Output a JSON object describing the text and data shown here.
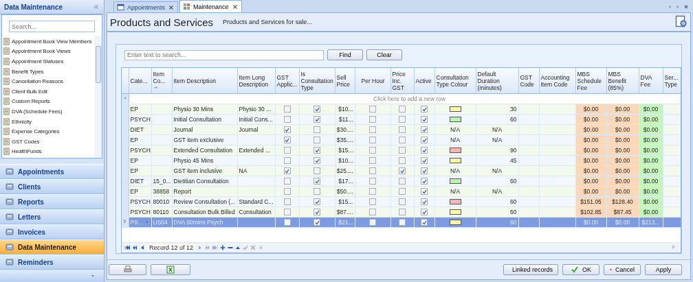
{
  "sidebar": {
    "title": "Data Maintenance",
    "search": {
      "placeholder": "Search..."
    },
    "items": [
      {
        "label": "Appointment Book View Members"
      },
      {
        "label": "Appointment Book Views"
      },
      {
        "label": "Appointment Statuses"
      },
      {
        "label": "Benefit Types"
      },
      {
        "label": "Cancellation Reasons"
      },
      {
        "label": "Client Bulk Edit"
      },
      {
        "label": "Custom Reports"
      },
      {
        "label": "DVA (Schedule Fees)"
      },
      {
        "label": "Ethnicity"
      },
      {
        "label": "Expense Categories"
      },
      {
        "label": "GST Codes"
      },
      {
        "label": "HealthFunds"
      }
    ],
    "nav": [
      {
        "label": "Appointments",
        "selected": false
      },
      {
        "label": "Clients",
        "selected": false
      },
      {
        "label": "Reports",
        "selected": false
      },
      {
        "label": "Letters",
        "selected": false
      },
      {
        "label": "Invoices",
        "selected": false
      },
      {
        "label": "Data Maintenance",
        "selected": true
      },
      {
        "label": "Reminders",
        "selected": false
      }
    ]
  },
  "tabs": [
    {
      "label": "Appointments",
      "selected": false
    },
    {
      "label": "Maintenance",
      "selected": true
    }
  ],
  "header": {
    "title": "Products and Services",
    "subtitle": "Products and Services for sale..."
  },
  "search": {
    "placeholder": "Enter text to search...",
    "buttons": [
      "Find",
      "Clear"
    ]
  },
  "table": {
    "columns": [
      {
        "label": "Cate...",
        "sorted": false
      },
      {
        "label": "Item Co...",
        "sorted": true
      },
      {
        "label": "Item Description",
        "sorted": false
      },
      {
        "label": "Item Long Description",
        "sorted": false
      },
      {
        "label": "GST Applic...",
        "sorted": false
      },
      {
        "label": "Is Consultation Type",
        "sorted": false
      },
      {
        "label": "Sell Price",
        "sorted": false
      },
      {
        "label": "Per Hour",
        "sorted": false
      },
      {
        "label": "Price Inc. GST",
        "sorted": false
      },
      {
        "label": "Active",
        "sorted": false
      },
      {
        "label": "Consultation Type Colour",
        "sorted": false
      },
      {
        "label": "Default Duration (minutes)",
        "sorted": false
      },
      {
        "label": "GST Code",
        "sorted": false
      },
      {
        "label": "Accounting Item Code",
        "sorted": false
      },
      {
        "label": "MBS Schedule Fee",
        "sorted": false
      },
      {
        "label": "MBS Benefit (85%)",
        "sorted": false
      },
      {
        "label": "DVA Fee",
        "sorted": false
      },
      {
        "label": "Ser... Type",
        "sorted": false
      }
    ],
    "new_row": "Click here to add a new row",
    "rows": [
      {
        "category": "EP",
        "description": "Physio 30 Mins",
        "long_description": "Physio 30 ...",
        "gst_applicable": false,
        "consultation": true,
        "sell_price": "$10...",
        "per_hour": false,
        "price_inc_gst": false,
        "active": true,
        "color": "#fbf7a6",
        "duration": "30",
        "mbs_fee": "$0.00",
        "mbs_benefit": "$0.00",
        "dva_fee": "$0.00",
        "selected": false
      },
      {
        "category": "PSYCH",
        "description": "Initial Consultation",
        "long_description": "Initial Cons...",
        "gst_applicable": false,
        "consultation": true,
        "sell_price": "$11...",
        "per_hour": false,
        "price_inc_gst": false,
        "active": true,
        "color": "#b9f2b2",
        "duration": "60",
        "mbs_fee": "$0.00",
        "mbs_benefit": "$0.00",
        "dva_fee": "$0.00",
        "selected": false
      },
      {
        "category": "DIET",
        "description": "Journal",
        "long_description": "Journal",
        "gst_applicable": true,
        "consultation": false,
        "sell_price": "$30....",
        "per_hour": false,
        "price_inc_gst": false,
        "active": true,
        "colour_text": "N/A",
        "duration": "N/A",
        "mbs_fee": "$0.00",
        "mbs_benefit": "$0.00",
        "dva_fee": "$0.00",
        "selected": false
      },
      {
        "category": "EP",
        "description": "GST item exclusive",
        "gst_applicable": true,
        "consultation": false,
        "sell_price": "$35....",
        "per_hour": false,
        "price_inc_gst": false,
        "active": true,
        "colour_text": "N/A",
        "duration": "N/A",
        "mbs_fee": "$0.00",
        "mbs_benefit": "$0.00",
        "dva_fee": "$0.00",
        "selected": false
      },
      {
        "category": "PSYCH",
        "description": "Extended Consultation",
        "long_description": "Extended ...",
        "gst_applicable": false,
        "consultation": true,
        "sell_price": "$15...",
        "per_hour": false,
        "price_inc_gst": false,
        "active": true,
        "color": "#f7b5b5",
        "duration": "90",
        "mbs_fee": "$0.00",
        "mbs_benefit": "$0.00",
        "dva_fee": "$0.00",
        "selected": false
      },
      {
        "category": "EP",
        "description": "Physio 45 Mins",
        "gst_applicable": false,
        "consultation": true,
        "sell_price": "$10...",
        "per_hour": false,
        "price_inc_gst": false,
        "active": true,
        "color": "#fbf7a6",
        "duration": "45",
        "mbs_fee": "$0.00",
        "mbs_benefit": "$0.00",
        "dva_fee": "$0.00",
        "selected": false
      },
      {
        "category": "EP",
        "description": "GST item inclusive",
        "long_description": "NA",
        "gst_applicable": true,
        "consultation": false,
        "sell_price": "$25....",
        "per_hour": false,
        "price_inc_gst": true,
        "active": true,
        "colour_text": "N/A",
        "duration": "N/A",
        "mbs_fee": "$0.00",
        "mbs_benefit": "$0.00",
        "dva_fee": "$0.00",
        "selected": false
      },
      {
        "category": "DIET",
        "code": "15_0...",
        "description": "Dietitian Consultation",
        "gst_applicable": false,
        "consultation": true,
        "sell_price": "$17...",
        "per_hour": false,
        "price_inc_gst": false,
        "active": true,
        "color": "#b9f2b2",
        "duration": "60",
        "mbs_fee": "$0.00",
        "mbs_benefit": "$0.00",
        "dva_fee": "$0.00",
        "selected": false
      },
      {
        "category": "EP",
        "code": "38858",
        "description": "Report",
        "gst_applicable": false,
        "consultation": false,
        "sell_price": "$50....",
        "per_hour": false,
        "price_inc_gst": false,
        "active": true,
        "colour_text": "N/A",
        "duration": "N/A",
        "mbs_fee": "$0.00",
        "mbs_benefit": "$0.00",
        "dva_fee": "$0.00",
        "selected": false
      },
      {
        "category": "PSYCH",
        "code": "80010",
        "description": "Review Consultation (...",
        "long_description": "Standard C...",
        "gst_applicable": false,
        "consultation": true,
        "sell_price": "$15...",
        "per_hour": false,
        "price_inc_gst": false,
        "active": true,
        "color": "#f7b5b5",
        "duration": "60",
        "mbs_fee": "$151.05",
        "mbs_benefit": "$128.40",
        "dva_fee": "$0.00",
        "selected": false
      },
      {
        "category": "PSYCH",
        "code": "80110",
        "description": "Consultation Bulk Billed",
        "long_description": "Consultation",
        "gst_applicable": false,
        "consultation": true,
        "sell_price": "$87....",
        "per_hour": false,
        "price_inc_gst": false,
        "active": true,
        "color": "#fbf7a6",
        "duration": "60",
        "mbs_fee": "$102.85",
        "mbs_benefit": "$87.45",
        "dva_fee": "$0.00",
        "selected": false
      },
      {
        "category": "PS...",
        "code": "US04",
        "description": "DVA 50mins Psych",
        "gst_applicable": false,
        "consultation": true,
        "sell_price": "$21...",
        "per_hour": false,
        "price_inc_gst": false,
        "active": true,
        "color": "#fbf7a6",
        "duration": "60",
        "mbs_fee": "$0.00",
        "mbs_benefit": "$0.00",
        "dva_fee": "$213...",
        "selected": true
      }
    ],
    "navigator": "Record 12 of 12"
  },
  "footer": {
    "buttons": [
      "Linked records",
      "OK",
      "Cancel",
      "Apply"
    ]
  }
}
